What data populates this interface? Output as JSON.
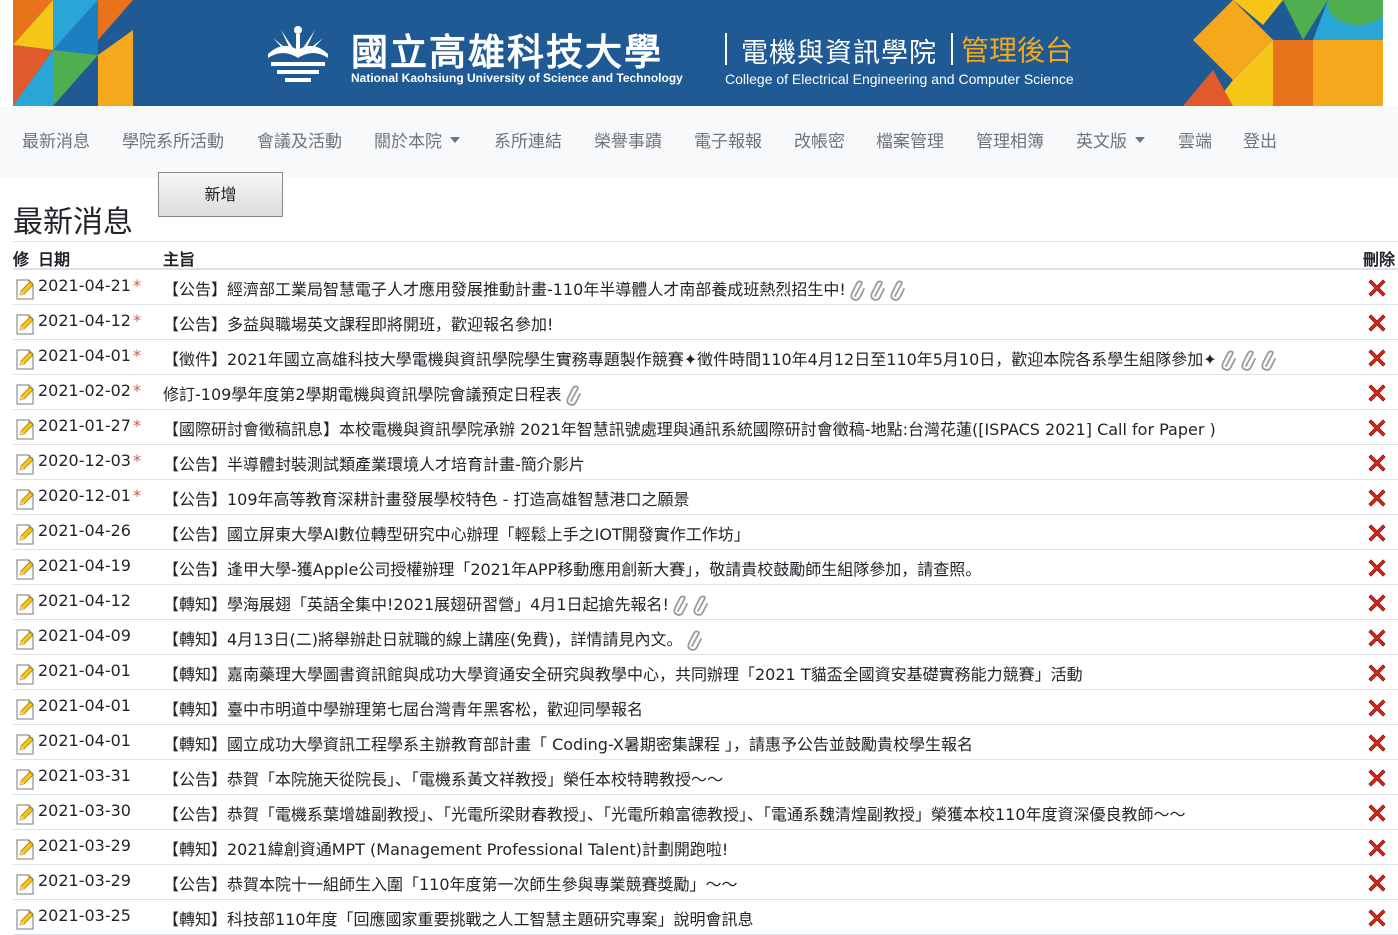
{
  "banner": {
    "university_zh": "國立高雄科技大學",
    "university_en": "National Kaohsiung University of Science and Technology",
    "college_zh": "電機與資訊學院",
    "admin_zh": "管理後台",
    "college_en": "College of Electrical Engineering and Computer Science",
    "colors": {
      "background": "#1f5a94",
      "accent": "#f5a81c"
    }
  },
  "nav": {
    "items": [
      {
        "label": "最新消息"
      },
      {
        "label": "學院系所活動"
      },
      {
        "label": "會議及活動"
      },
      {
        "label": "關於本院",
        "dropdown": true
      },
      {
        "label": "系所連結"
      },
      {
        "label": "榮譽事蹟"
      },
      {
        "label": "電子報報"
      },
      {
        "label": "改帳密"
      },
      {
        "label": "檔案管理"
      },
      {
        "label": "管理相簿"
      },
      {
        "label": "英文版",
        "dropdown": true
      },
      {
        "label": "雲端"
      },
      {
        "label": "登出"
      }
    ]
  },
  "page": {
    "title": "最新消息",
    "add_button": "新增"
  },
  "table": {
    "headers": {
      "edit": "修",
      "date": "日期",
      "subject": "主旨",
      "delete": "刪除"
    },
    "rows": [
      {
        "date": "2021-04-21",
        "pinned": true,
        "subject": "【公告】經濟部工業局智慧電子人才應用發展推動計畫-110年半導體人才南部養成班熱烈招生中!",
        "attachments": 3
      },
      {
        "date": "2021-04-12",
        "pinned": true,
        "subject": "【公告】多益與職場英文課程即將開班，歡迎報名參加!",
        "attachments": 0
      },
      {
        "date": "2021-04-01",
        "pinned": true,
        "subject": "【徵件】2021年國立高雄科技大學電機與資訊學院學生實務專題製作競賽✦徵件時間110年4月12日至110年5月10日，歡迎本院各系學生組隊參加✦",
        "attachments": 3
      },
      {
        "date": "2021-02-02",
        "pinned": true,
        "subject": "修訂-109學年度第2學期電機與資訊學院會議預定日程表",
        "attachments": 1
      },
      {
        "date": "2021-01-27",
        "pinned": true,
        "subject": "【國際研討會徵稿訊息】本校電機與資訊學院承辦 2021年智慧訊號處理與通訊系統國際研討會徵稿-地點:台灣花蓮([ISPACS 2021] Call for Paper )",
        "attachments": 0
      },
      {
        "date": "2020-12-03",
        "pinned": true,
        "subject": "【公告】半導體封裝測試類產業環境人才培育計畫-簡介影片",
        "attachments": 0
      },
      {
        "date": "2020-12-01",
        "pinned": true,
        "subject": "【公告】109年高等教育深耕計畫發展學校特色 - 打造高雄智慧港口之願景",
        "attachments": 0
      },
      {
        "date": "2021-04-26",
        "pinned": false,
        "subject": "【公告】國立屏東大學AI數位轉型研究中心辦理「輕鬆上手之IOT開發實作工作坊」",
        "attachments": 0
      },
      {
        "date": "2021-04-19",
        "pinned": false,
        "subject": "【公告】逢甲大學-獲Apple公司授權辦理「2021年APP移動應用創新大賽」，敬請貴校鼓勵師生組隊參加，請查照。",
        "attachments": 0
      },
      {
        "date": "2021-04-12",
        "pinned": false,
        "subject": "【轉知】學海展翅「英語全集中!2021展翅研習營」4月1日起搶先報名!",
        "attachments": 2
      },
      {
        "date": "2021-04-09",
        "pinned": false,
        "subject": "【轉知】4月13日(二)將舉辦赴日就職的線上講座(免費)，詳情請見內文。",
        "attachments": 1
      },
      {
        "date": "2021-04-01",
        "pinned": false,
        "subject": "【轉知】嘉南藥理大學圖書資訊館與成功大學資通安全研究與教學中心，共同辦理「2021 T貓盃全國資安基礎實務能力競賽」活動",
        "attachments": 0
      },
      {
        "date": "2021-04-01",
        "pinned": false,
        "subject": "【轉知】臺中市明道中學辦理第七屆台灣青年黑客松，歡迎同學報名",
        "attachments": 0
      },
      {
        "date": "2021-04-01",
        "pinned": false,
        "subject": "【轉知】國立成功大學資訊工程學系主辦教育部計畫「 Coding-X暑期密集課程 」，請惠予公告並鼓勵貴校學生報名",
        "attachments": 0
      },
      {
        "date": "2021-03-31",
        "pinned": false,
        "subject": "【公告】恭賀「本院施天從院長」、「電機系黃文祥教授」榮任本校特聘教授～～",
        "attachments": 0
      },
      {
        "date": "2021-03-30",
        "pinned": false,
        "subject": "【公告】恭賀「電機系葉增雄副教授」、「光電所梁財春教授」、「光電所賴富德教授」、「電通系魏清煌副教授」榮獲本校110年度資深優良教師～～",
        "attachments": 0
      },
      {
        "date": "2021-03-29",
        "pinned": false,
        "subject": "【轉知】2021緯創資通MPT (Management Professional Talent)計劃開跑啦!",
        "attachments": 0
      },
      {
        "date": "2021-03-29",
        "pinned": false,
        "subject": "【公告】恭賀本院十一組師生入圍「110年度第一次師生參與專業競賽獎勵」～～",
        "attachments": 0
      },
      {
        "date": "2021-03-25",
        "pinned": false,
        "subject": "【轉知】科技部110年度「回應國家重要挑戰之人工智慧主題研究專案」說明會訊息",
        "attachments": 0
      }
    ]
  }
}
